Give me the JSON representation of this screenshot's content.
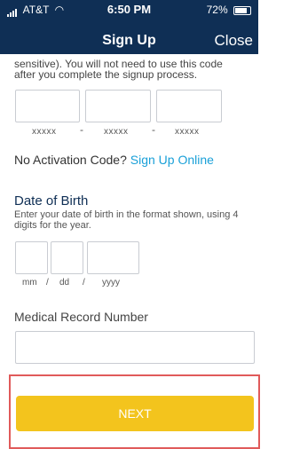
{
  "status_bar": {
    "carrier": "AT&T",
    "time": "6:50 PM",
    "battery": "72%"
  },
  "nav": {
    "title": "Sign Up",
    "close_label": "Close"
  },
  "activation": {
    "cut_line1": "sensitive). You will not need to use this code",
    "cut_line2": "after you complete the signup process.",
    "placeholders": [
      "xxxxx",
      "xxxxx",
      "xxxxx"
    ],
    "separator": "-"
  },
  "no_activation": {
    "label": "No Activation Code?",
    "link": "Sign Up Online"
  },
  "dob": {
    "title": "Date of Birth",
    "help": "Enter your date of birth in the format shown, using 4 digits for the year.",
    "month_placeholder": "mm",
    "day_placeholder": "dd",
    "year_placeholder": "yyyy",
    "separator": "/"
  },
  "medical_record": {
    "label": "Medical Record Number"
  },
  "next_button": {
    "label": "NEXT"
  },
  "colors": {
    "header": "#0f2f55",
    "link": "#1aa0d8",
    "primary_button": "#f3c41d",
    "highlight": "#e05a5a"
  }
}
